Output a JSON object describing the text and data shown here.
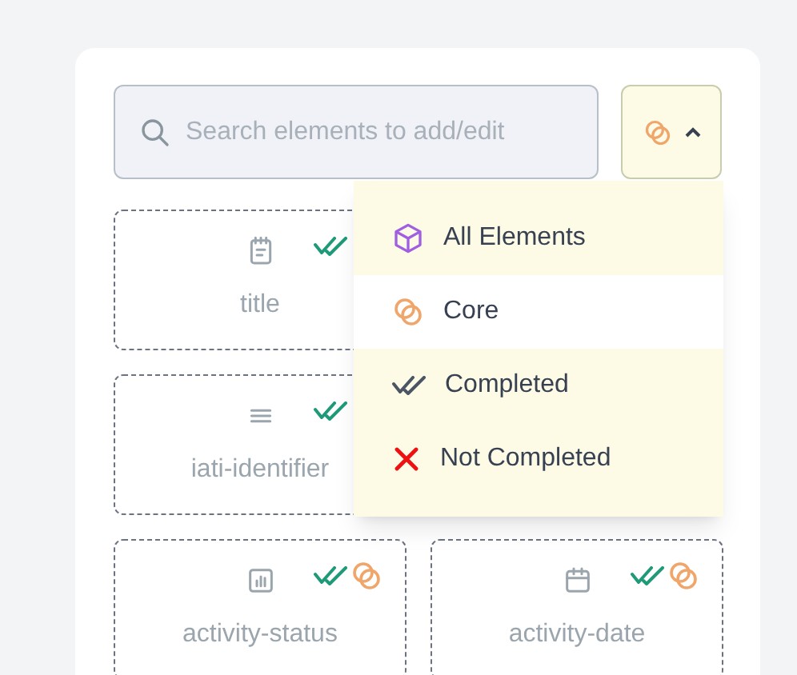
{
  "search": {
    "placeholder": "Search elements to add/edit"
  },
  "filter_button": {
    "expanded": true
  },
  "filter_menu": [
    {
      "label": "All Elements",
      "kind": "all",
      "selected": false
    },
    {
      "label": "Core",
      "kind": "core",
      "selected": true
    },
    {
      "label": "Completed",
      "kind": "completed",
      "selected": false
    },
    {
      "label": "Not Completed",
      "kind": "not_completed",
      "selected": false
    }
  ],
  "elements": [
    {
      "label": "title",
      "kind": "notepad",
      "completed": true
    },
    {
      "label": "iati-identifier",
      "kind": "lines",
      "completed": true
    },
    {
      "label": "activity-status",
      "kind": "chart",
      "completed": true,
      "core": true
    },
    {
      "label": "activity-date",
      "kind": "calendar",
      "completed": true,
      "core": true
    }
  ]
}
